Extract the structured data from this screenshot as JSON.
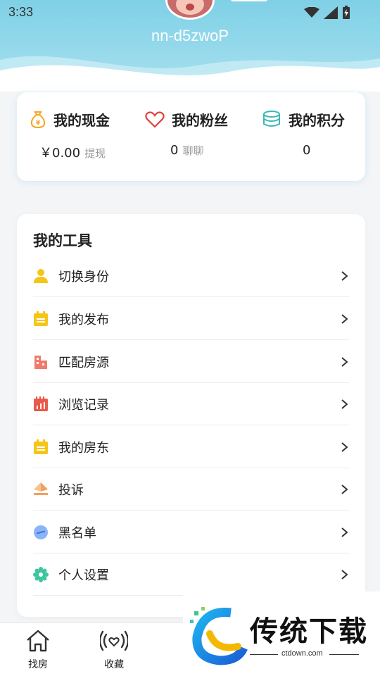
{
  "status_bar": {
    "time": "3:33"
  },
  "profile": {
    "username": "nn-d5zwoP"
  },
  "stats": [
    {
      "title": "我的现金",
      "value": "￥0.00",
      "action": "提现",
      "icon": "money-bag-icon"
    },
    {
      "title": "我的粉丝",
      "value": "0",
      "action": "聊聊",
      "icon": "heart-icon"
    },
    {
      "title": "我的积分",
      "value": "0",
      "action": "",
      "icon": "coins-icon"
    }
  ],
  "tools": {
    "title": "我的工具",
    "items": [
      {
        "label": "切换身份",
        "icon": "user-icon"
      },
      {
        "label": "我的发布",
        "icon": "calendar-icon"
      },
      {
        "label": "匹配房源",
        "icon": "building-icon"
      },
      {
        "label": "浏览记录",
        "icon": "chart-icon"
      },
      {
        "label": "我的房东",
        "icon": "calendar-icon"
      },
      {
        "label": "投诉",
        "icon": "complaint-icon"
      },
      {
        "label": "黑名单",
        "icon": "block-icon"
      },
      {
        "label": "个人设置",
        "icon": "settings-icon"
      }
    ]
  },
  "bottom_nav": [
    {
      "label": "找房",
      "icon": "home-icon"
    },
    {
      "label": "收藏",
      "icon": "favorite-signal-icon"
    },
    {
      "label": "",
      "icon": "partial-icon"
    }
  ],
  "watermark": {
    "title": "传统下载",
    "subtitle": "ctdown.com"
  },
  "colors": {
    "header": "#7fd0e6",
    "icon_yellow": "#f5c518",
    "icon_red": "#e0403a",
    "icon_teal": "#3bb8b8",
    "icon_coral": "#f07b6a",
    "icon_blue": "#8ab4f8",
    "icon_green": "#3cc6a0"
  }
}
